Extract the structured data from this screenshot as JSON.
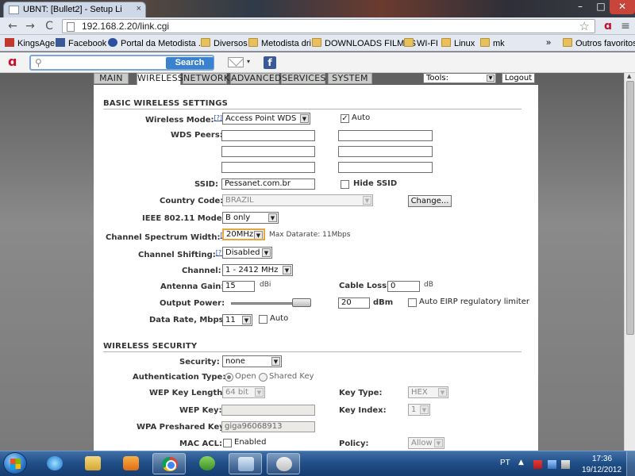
{
  "browser": {
    "tab_title": "UBNT: [Bullet2] - Setup Li",
    "tab_close": "×",
    "window_min": "–",
    "window_max": "□",
    "window_close": "✕",
    "back": "←",
    "forward": "→",
    "reload": "C",
    "url": "192.168.2.20/link.cgi",
    "bookmark_star": "☆",
    "menu": "≡",
    "bookmarks": [
      {
        "label": "KingsAge",
        "icon": "kingsage-icon"
      },
      {
        "label": "Facebook",
        "icon": "facebook-icon"
      },
      {
        "label": "Portal da Metodista ...",
        "icon": "portal-icon"
      },
      {
        "label": "Diversos",
        "icon": "folder-icon"
      },
      {
        "label": "Metodista dri",
        "icon": "folder-icon"
      },
      {
        "label": "DOWNLOADS FILMES",
        "icon": "folder-icon"
      },
      {
        "label": "WI-FI",
        "icon": "folder-icon"
      },
      {
        "label": "Linux",
        "icon": "folder-icon"
      },
      {
        "label": "mk",
        "icon": "folder-icon"
      }
    ],
    "other_bookmarks": "Outros favoritos",
    "bookmarks_overflow": "»"
  },
  "toolbar": {
    "search_value": "",
    "search_button": "Search",
    "facebook_letter": "f"
  },
  "nav": {
    "tabs": [
      "MAIN",
      "WIRELESS",
      "NETWORK",
      "ADVANCED",
      "SERVICES",
      "SYSTEM"
    ],
    "active_tab": "WIRELESS",
    "tools_label": "Tools:",
    "logout": "Logout"
  },
  "basic": {
    "section_title": "BASIC WIRELESS SETTINGS",
    "help_marker": "[?]",
    "wireless_mode_label": "Wireless Mode:",
    "wireless_mode_value": "Access Point WDS",
    "auto_label": "Auto",
    "auto_checked": true,
    "wds_peers_label": "WDS Peers:",
    "wds_peers": [
      "",
      "",
      "",
      "",
      "",
      ""
    ],
    "ssid_label": "SSID:",
    "ssid_value": "Pessanet.com.br",
    "hide_ssid_label": "Hide SSID",
    "hide_ssid_checked": false,
    "country_label": "Country Code:",
    "country_value": "BRAZIL",
    "change_button": "Change...",
    "ieee_label": "IEEE 802.11 Mode:",
    "ieee_value": "B only",
    "spectrum_label": "Channel Spectrum Width:",
    "spectrum_value": "20MHz",
    "max_datarate": "Max Datarate: 11Mbps",
    "shifting_label": "Channel Shifting:",
    "shifting_value": "Disabled",
    "channel_label": "Channel:",
    "channel_value": "1 - 2412 MHz",
    "antenna_gain_label": "Antenna Gain:",
    "antenna_gain_value": "15",
    "antenna_gain_unit": "dBi",
    "cable_loss_label": "Cable Loss:",
    "cable_loss_value": "0",
    "cable_loss_unit": "dB",
    "output_power_label": "Output Power:",
    "output_power_value": "20",
    "output_power_unit": "dBm",
    "output_power_level": 0.8,
    "eirp_label": "Auto EIRP regulatory limiter",
    "eirp_checked": false,
    "data_rate_label": "Data Rate, Mbps:",
    "data_rate_value": "11",
    "data_rate_auto_label": "Auto",
    "data_rate_auto_checked": false
  },
  "security": {
    "section_title": "WIRELESS SECURITY",
    "security_label": "Security:",
    "security_value": "none",
    "auth_label": "Authentication Type:",
    "auth_open": "Open",
    "auth_shared": "Shared Key",
    "wep_len_label": "WEP Key Length:",
    "wep_len_value": "64 bit",
    "key_type_label": "Key Type:",
    "key_type_value": "HEX",
    "wep_key_label": "WEP Key:",
    "wep_key_value": "",
    "key_index_label": "Key Index:",
    "key_index_value": "1",
    "wpa_label": "WPA Preshared Key:",
    "wpa_value": "giga96068913",
    "mac_acl_label": "MAC ACL:",
    "mac_acl_enabled_label": "Enabled",
    "policy_label": "Policy:",
    "policy_value": "Allow"
  },
  "taskbar": {
    "language": "PT",
    "tray_caret": "▲",
    "time": "17:36",
    "date": "19/12/2012"
  },
  "colors": {
    "accent_blue": "#3a82d0",
    "focus_orange": "#e6a640",
    "avira_red": "#c8102e"
  }
}
